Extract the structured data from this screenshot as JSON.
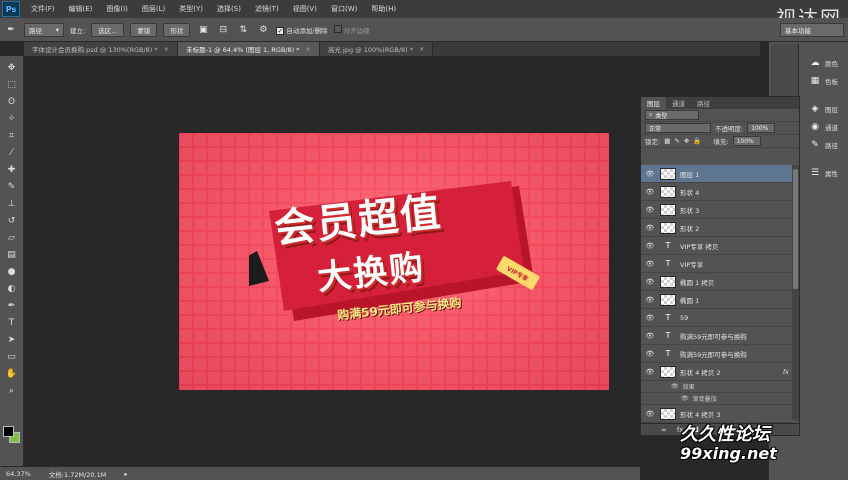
{
  "app": {
    "logo": "Ps",
    "brand": "视达网"
  },
  "menu": [
    "文件(F)",
    "编辑(E)",
    "图像(I)",
    "图层(L)",
    "类型(Y)",
    "选择(S)",
    "滤镜(T)",
    "视图(V)",
    "窗口(W)",
    "帮助(H)"
  ],
  "options": {
    "tool_mode": "路径",
    "make_label": "建立:",
    "selection_btn": "选区...",
    "mask_btn": "蒙版",
    "shape_btn": "形状",
    "auto_add_label": "自动添加/删除",
    "align_edges_label": "对齐边缘",
    "workspace": "基本功能"
  },
  "tabs": [
    {
      "label": "字体设计会员换购.psd @ 130%(RGB/8) *"
    },
    {
      "label": "未标题-1 @ 64.4% (图层 1, RGB/8) *"
    },
    {
      "label": "高光.jpg @ 100%(RGB/8) *"
    }
  ],
  "canvas": {
    "title_line1": "会员超值",
    "title_line2": "大换购",
    "subtitle": "购满59元即可参与换购",
    "tag": "VIP专享"
  },
  "status": {
    "zoom": "64.37%",
    "doc": "文档:1.72M/20.1M"
  },
  "right_column": {
    "items": [
      {
        "icon": "☁",
        "label": "颜色"
      },
      {
        "icon": "▦",
        "label": "色板"
      },
      {
        "icon": "◈",
        "label": "图层"
      },
      {
        "icon": "◉",
        "label": "通道"
      },
      {
        "icon": "✎",
        "label": "路径"
      },
      {
        "icon": "☰",
        "label": "属性"
      }
    ]
  },
  "layers_panel": {
    "tabs": [
      "图层",
      "通道",
      "路径"
    ],
    "search_placeholder": "类型",
    "blend_mode": "正常",
    "opacity_label": "不透明度:",
    "opacity": "100%",
    "lock_label": "锁定:",
    "fill_label": "填充:",
    "fill": "100%",
    "layers": [
      {
        "name": "图层 1",
        "kind": "pixel",
        "selected": true
      },
      {
        "name": "形状 4",
        "kind": "shape"
      },
      {
        "name": "形状 3",
        "kind": "shape"
      },
      {
        "name": "形状 2",
        "kind": "shape"
      },
      {
        "name": "VIP专享 拷贝",
        "kind": "text"
      },
      {
        "name": "VIP专享",
        "kind": "text"
      },
      {
        "name": "椭圆 1 拷贝",
        "kind": "shape"
      },
      {
        "name": "椭圆 1",
        "kind": "shape"
      },
      {
        "name": "59",
        "kind": "text"
      },
      {
        "name": "购满59元即可参与换购",
        "kind": "text"
      },
      {
        "name": "购满59元即可参与换购",
        "kind": "text"
      },
      {
        "name": "形状 4 拷贝 2",
        "kind": "shape",
        "fx": "fx"
      },
      {
        "name": "形状 4 拷贝 3",
        "kind": "shape"
      }
    ],
    "effects": {
      "title": "效果",
      "item": "渐变叠加"
    }
  },
  "watermark": {
    "line1": "久久性论坛",
    "line2": "99xing.net"
  },
  "colors": {
    "accent_selected": "#5f7690",
    "artboard_red": "#f34a5c",
    "fg_color": "#000000",
    "bg_color": "#7fc242"
  }
}
